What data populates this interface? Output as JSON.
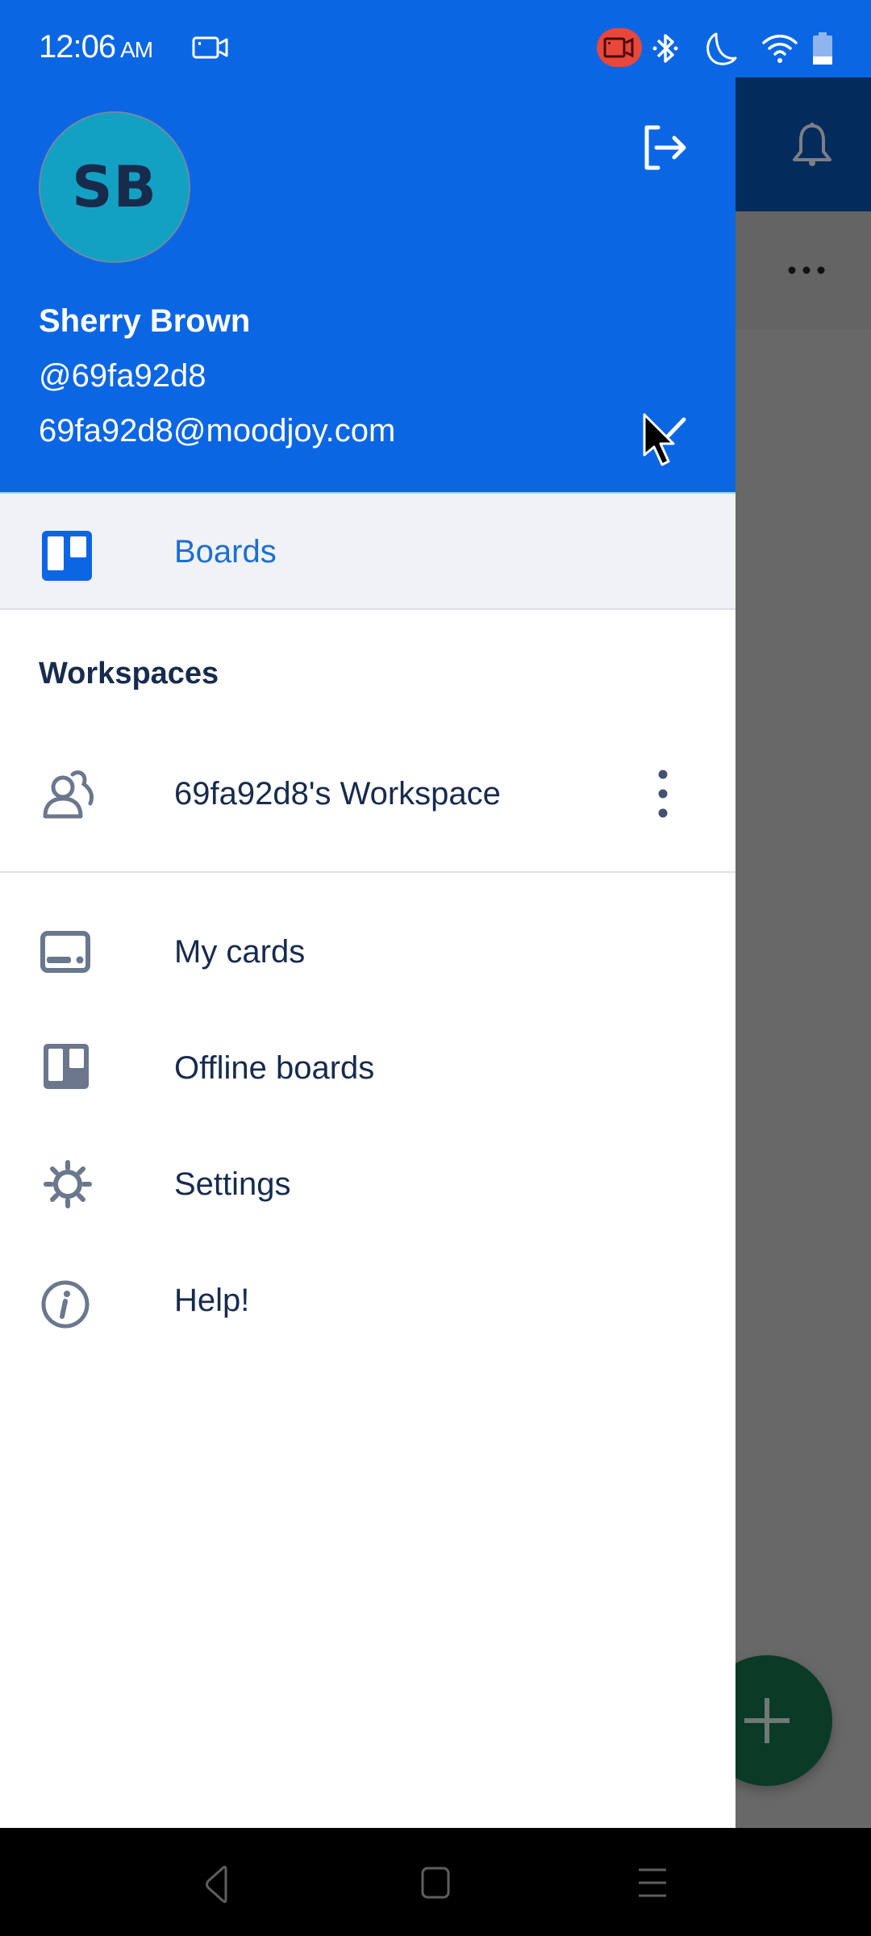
{
  "status_bar": {
    "time": "12:06",
    "ampm": "AM",
    "icons": [
      "screen-record-icon",
      "recording-active-icon",
      "bluetooth-icon",
      "do-not-disturb-moon-icon",
      "wifi-icon",
      "battery-icon"
    ]
  },
  "drawer": {
    "avatar_initials": "SB",
    "user_name": "Sherry Brown",
    "user_handle": "@69fa92d8",
    "user_email": "69fa92d8@moodjoy.com",
    "logout_icon": "logout-icon",
    "account_toggle_icon": "chevron-down-icon",
    "selected_item": {
      "label": "Boards",
      "icon": "boards-icon"
    },
    "workspaces_heading": "Workspaces",
    "workspaces": [
      {
        "label": "69fa92d8's Workspace",
        "icon": "team-icon",
        "menu_icon": "more-vertical-icon"
      }
    ],
    "menu": [
      {
        "label": "My cards",
        "icon": "cards-icon"
      },
      {
        "label": "Offline boards",
        "icon": "offline-boards-icon"
      },
      {
        "label": "Settings",
        "icon": "gear-icon"
      },
      {
        "label": "Help!",
        "icon": "info-icon"
      }
    ]
  },
  "background_app": {
    "notification_icon": "bell-icon",
    "overflow_icon": "more-horizontal-icon",
    "fab_icon": "plus-icon"
  },
  "nav_bar": {
    "buttons": [
      "back",
      "home",
      "recents"
    ]
  },
  "colors": {
    "header_blue": "#0b66e4",
    "accent_text": "#1c6ed4",
    "text_primary": "#172b4d",
    "icon_gray": "#6b778c",
    "avatar_bg": "#12a1c3",
    "scrim": "#686868",
    "fab": "#0b3a27",
    "record_red": "#e9473b"
  }
}
